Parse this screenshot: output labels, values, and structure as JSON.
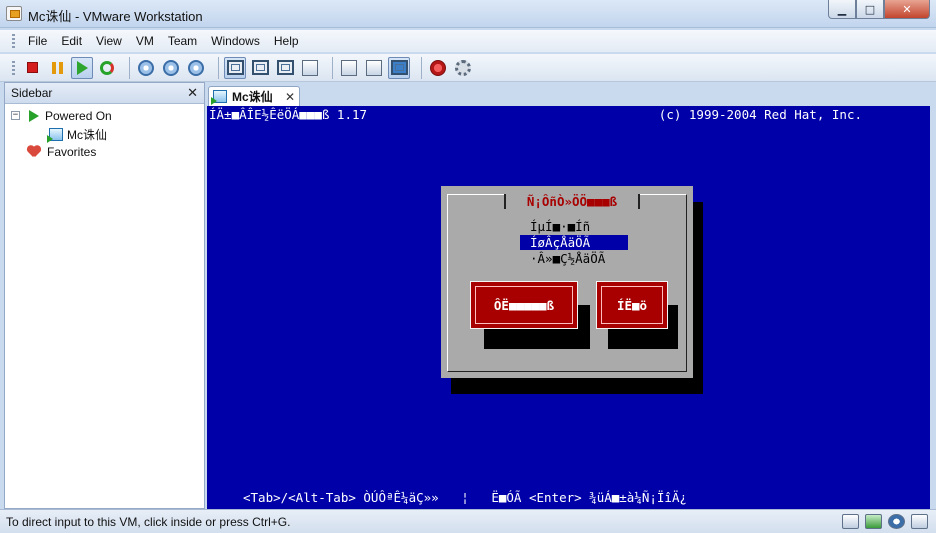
{
  "window": {
    "title": "Mc诛仙 - VMware Workstation",
    "controls": {
      "minimize": "▁",
      "maximize": "□",
      "close": "✕"
    }
  },
  "menu": [
    "File",
    "Edit",
    "View",
    "VM",
    "Team",
    "Windows",
    "Help"
  ],
  "toolbar": {
    "groups": [
      [
        "stop-icon",
        "pause-icon",
        "play-icon",
        "reset-icon"
      ],
      [
        "snapshot-icon",
        "revert-snapshot-icon",
        "manage-snapshots-icon"
      ],
      [
        "show-sidebar-icon",
        "full-screen-icon",
        "quick-switch-icon",
        "console-view-icon"
      ],
      [
        "summary-view-icon",
        "appliance-view-icon",
        "vm-console-icon"
      ],
      [
        "record-icon",
        "settings-icon"
      ]
    ]
  },
  "sidebar": {
    "title": "Sidebar",
    "close": "✕",
    "tree": [
      {
        "label": "Powered On",
        "expander": "−",
        "icon": "powered-on-icon"
      },
      {
        "label": "Mc诛仙",
        "icon": "vm-icon"
      },
      {
        "label": "Favorites",
        "icon": "favorites-heart-icon"
      }
    ]
  },
  "tab": {
    "label": "Mc诛仙",
    "close": "✕"
  },
  "vm": {
    "top_left": "ÍÄ±■ÂÎE½ÊëÖÁ■■■ß 1.17",
    "top_right": "(c) 1999-2004 Red Hat, Inc.",
    "dialog": {
      "title": "Ñ¡ÔñÒ»ÖÖ■■■ß",
      "options": [
        "ÍµÍ■·■Íñ",
        "ÍøÂçÅäÖÃ",
        "·Â»■Ç½ÅäÖÃ"
      ],
      "selected_index": 1,
      "buttons": [
        "ÔË■■■■■ß",
        "ÍË■ö"
      ]
    },
    "bottom_hint": "<Tab>/<Alt-Tab> ÒÚÔªÊ¼äÇ»»   ¦   Ë■ÓÃ <Enter> ¾üÁ■±à¼­Ñ¡ÏîÄ¿"
  },
  "status": {
    "text": "To direct input to this VM, click inside or press Ctrl+G.",
    "icons": [
      "hard-disk-icon",
      "network-icon",
      "sound-icon",
      "message-log-icon"
    ]
  },
  "colors": {
    "vm_background": "#0000a8",
    "dialog_gray": "#aaaaaa",
    "button_red": "#a80000"
  }
}
